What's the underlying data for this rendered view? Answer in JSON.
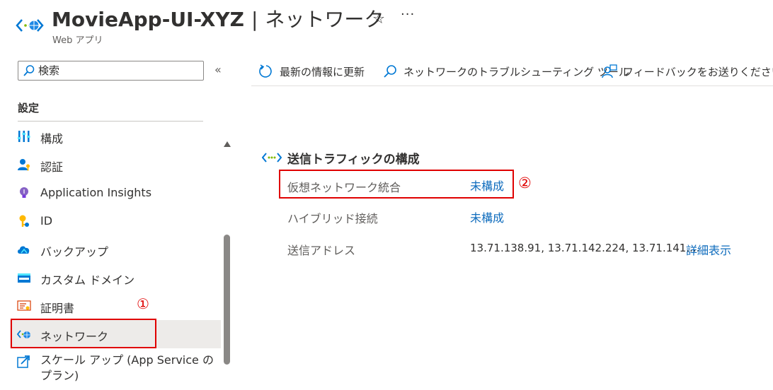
{
  "header": {
    "resource_name": "MovieApp-UI-XYZ",
    "separator": "|",
    "page_name": "ネットワーク",
    "resource_type": "Web アプリ",
    "favorite_glyph": "☆",
    "more_glyph": "···"
  },
  "sidebar": {
    "search_placeholder": "検索",
    "collapse_glyph": "«",
    "section_title": "設定",
    "items": [
      {
        "label": "構成",
        "icon": "sliders-icon"
      },
      {
        "label": "認証",
        "icon": "user-key-icon"
      },
      {
        "label": "Application Insights",
        "icon": "lightbulb-icon"
      },
      {
        "label": "ID",
        "icon": "identity-key-icon"
      },
      {
        "label": "バックアップ",
        "icon": "cloud-backup-icon"
      },
      {
        "label": "カスタム ドメイン",
        "icon": "www-domain-icon"
      },
      {
        "label": "証明書",
        "icon": "certificate-icon"
      },
      {
        "label": "ネットワーク",
        "icon": "network-icon",
        "active": true
      },
      {
        "label": "スケール アップ (App Service のプラン)",
        "icon": "scale-up-icon"
      }
    ],
    "marker_1": "①"
  },
  "toolbar": {
    "refresh_label": "最新の情報に更新",
    "troubleshoot_label": "ネットワークのトラブルシューティング ツール",
    "feedback_label": "フィードバックをお送りください"
  },
  "main": {
    "section_title": "送信トラフィックの構成",
    "rows": [
      {
        "label": "仮想ネットワーク統合",
        "value": "未構成"
      },
      {
        "label": "ハイブリッド接続",
        "value": "未構成"
      },
      {
        "label": "送信アドレス",
        "value": "13.71.138.91, 13.71.142.224, 13.71.141....",
        "link": "詳細表示"
      }
    ],
    "marker_2": "②"
  },
  "colors": {
    "accent_link": "#0f6cbd",
    "highlight_red": "#e00000",
    "active_bg": "#edebe9"
  }
}
